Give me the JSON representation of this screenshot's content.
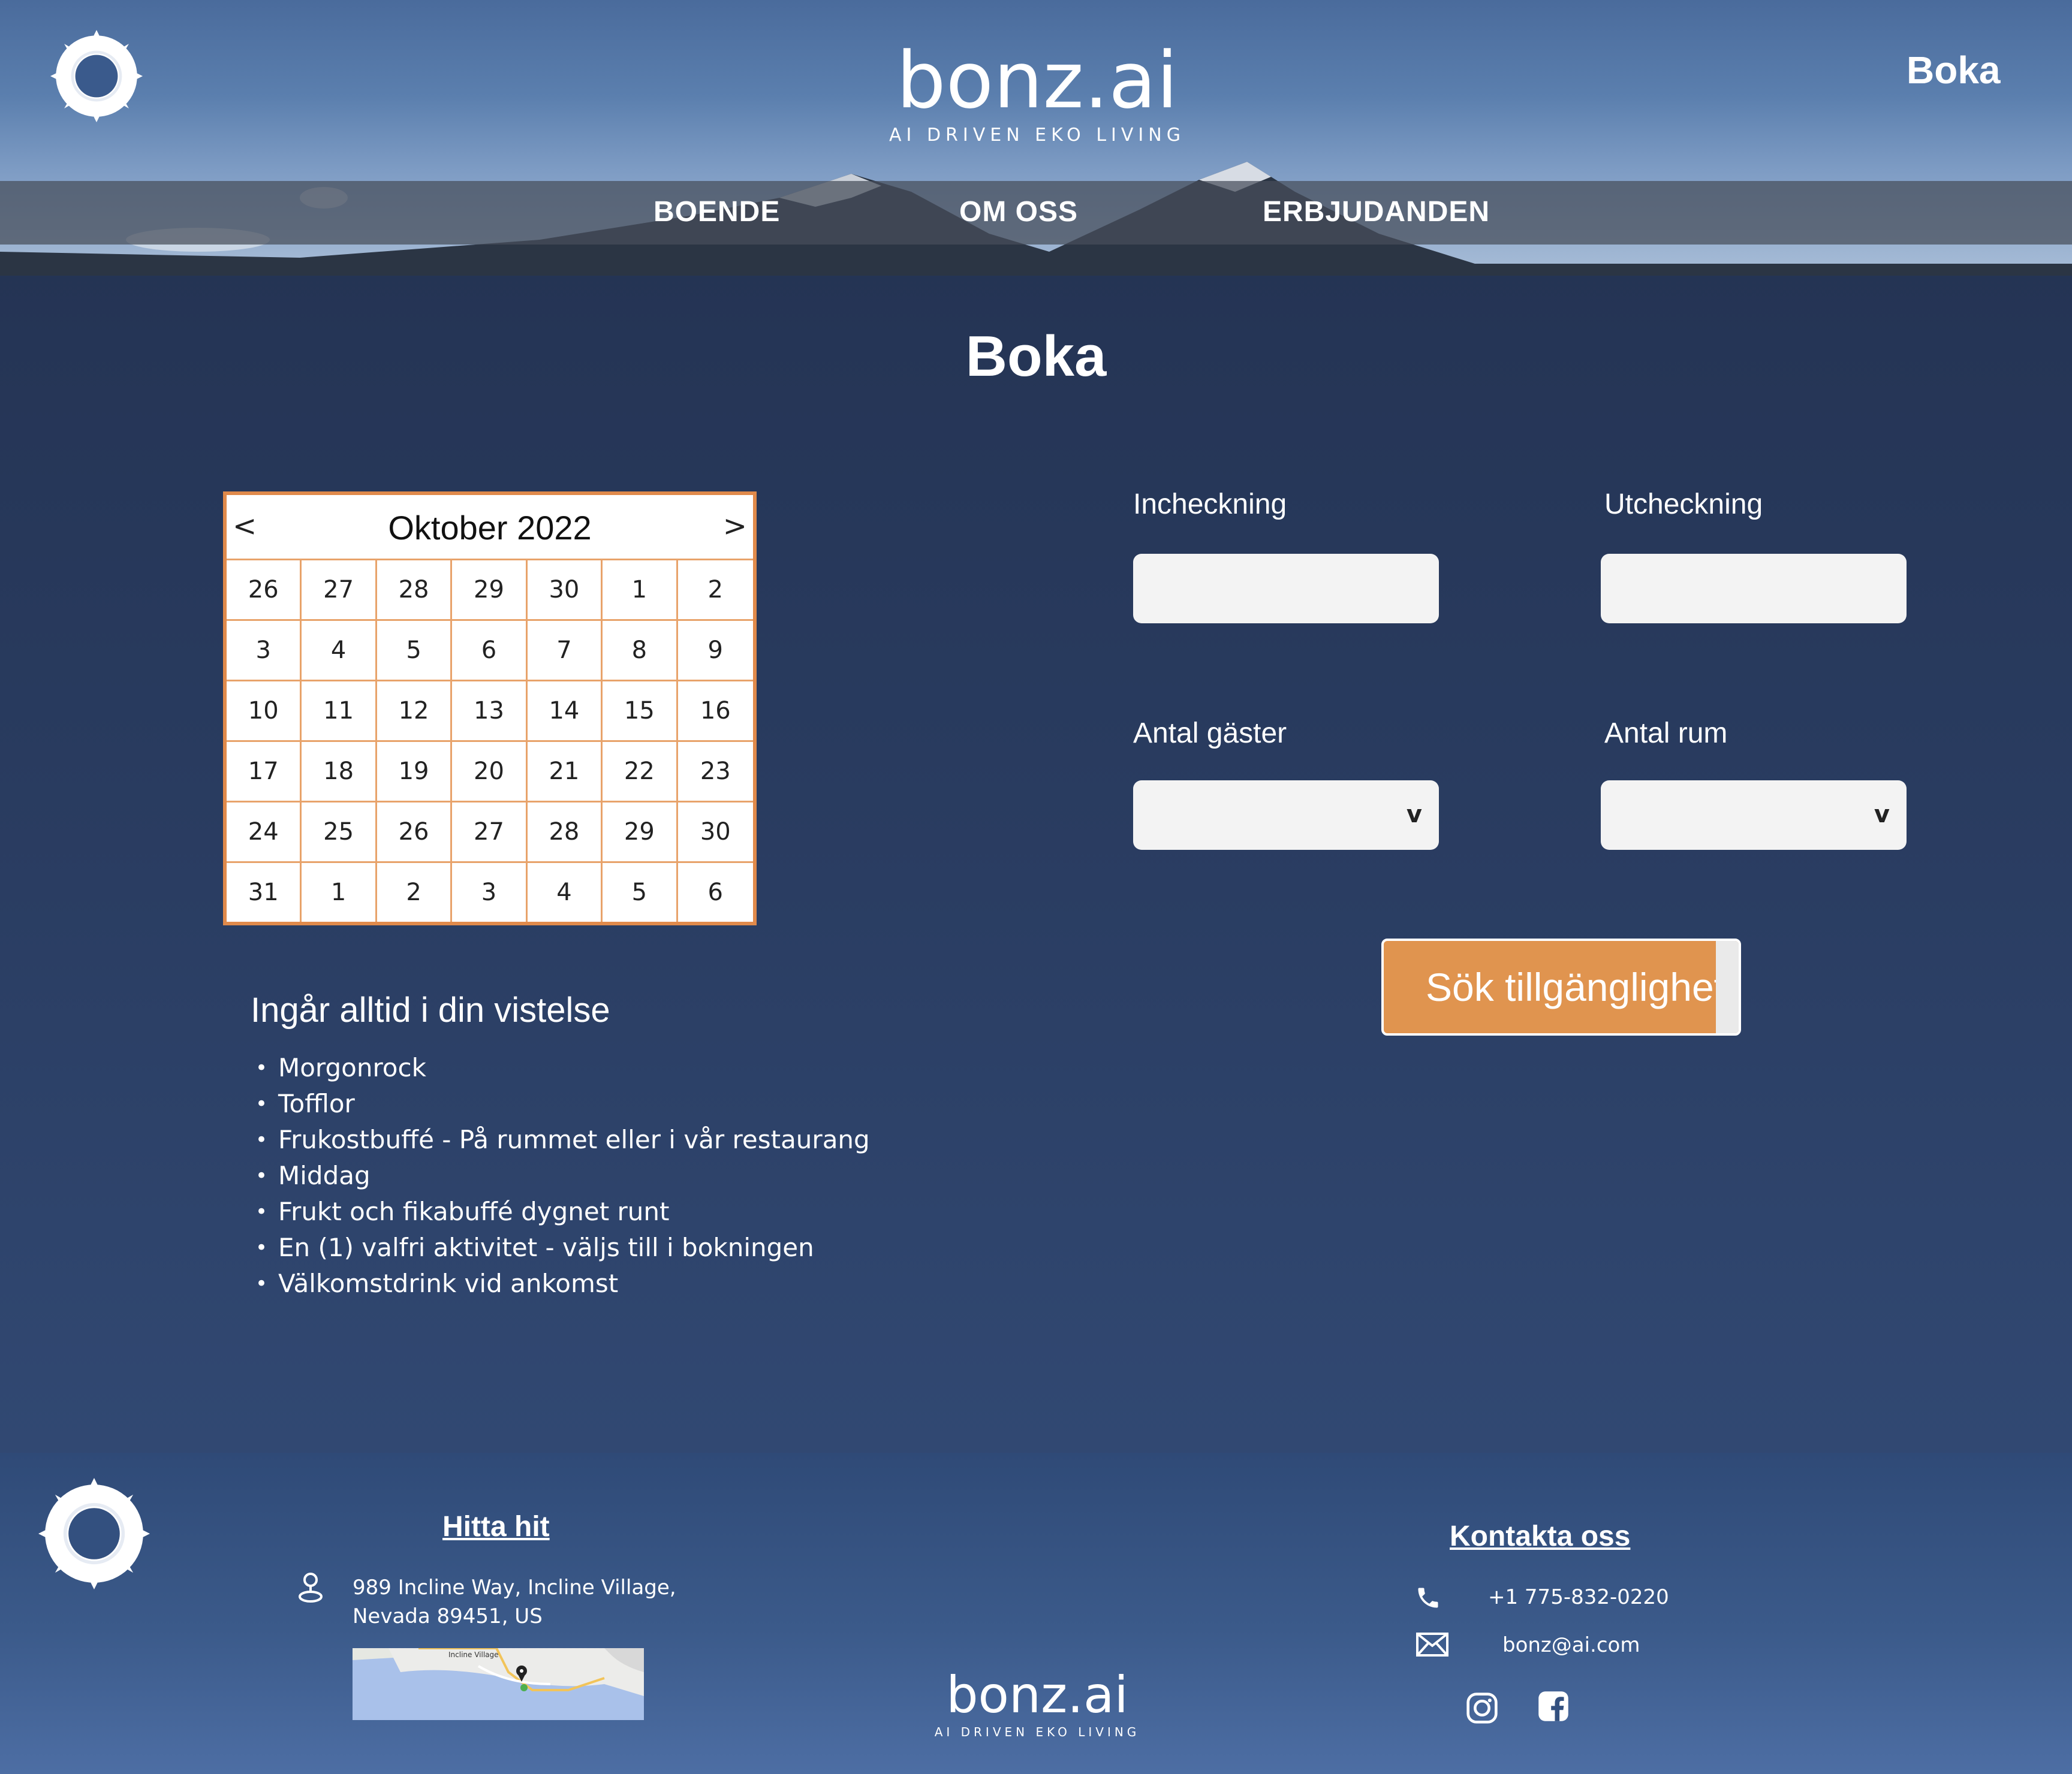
{
  "header": {
    "brand_name": "bonz.ai",
    "brand_tagline": "AI DRIVEN EKO LIVING",
    "top_link": "Boka"
  },
  "nav": {
    "items": [
      "BOENDE",
      "OM OSS",
      "ERBJUDANDEN"
    ]
  },
  "page": {
    "title": "Boka"
  },
  "calendar": {
    "month_label": "Oktober 2022",
    "prev_label": "<",
    "next_label": ">",
    "days": [
      [
        "26",
        "27",
        "28",
        "29",
        "30",
        "1",
        "2"
      ],
      [
        "3",
        "4",
        "5",
        "6",
        "7",
        "8",
        "9"
      ],
      [
        "10",
        "11",
        "12",
        "13",
        "14",
        "15",
        "16"
      ],
      [
        "17",
        "18",
        "19",
        "20",
        "21",
        "22",
        "23"
      ],
      [
        "24",
        "25",
        "26",
        "27",
        "28",
        "29",
        "30"
      ],
      [
        "31",
        "1",
        "2",
        "3",
        "4",
        "5",
        "6"
      ]
    ]
  },
  "included": {
    "title": "Ingår alltid i din vistelse",
    "items": [
      "Morgonrock",
      "Tofflor",
      "Frukostbuffé - På rummet eller i vår restaurang",
      "Middag",
      "Frukt och fikabuffé dygnet runt",
      "En (1) valfri aktivitet  - väljs till i bokningen",
      "Välkomstdrink vid ankomst"
    ]
  },
  "form": {
    "checkin_label": "Incheckning",
    "checkout_label": "Utcheckning",
    "guests_label": "Antal gäster",
    "rooms_label": "Antal rum",
    "select_chevron": "v",
    "search_button": "Sök tillgänglighet"
  },
  "footer": {
    "find_heading": "Hitta hit",
    "address_line1": "989 Incline Way, Incline Village,",
    "address_line2": "Nevada 89451, US",
    "contact_heading": "Kontakta oss",
    "phone": "+1 775-832-0220",
    "email": "bonz@ai.com",
    "brand_name": "bonz.ai",
    "brand_tagline": "AI DRIVEN EKO LIVING",
    "map_label": "Incline Village"
  },
  "colors": {
    "accent": "#e0944f",
    "calendar_border": "#e08a4b",
    "background_top": "#22304e",
    "background_bottom": "#354f7c"
  },
  "icons": [
    "sun-logo-icon",
    "location-pin-icon",
    "phone-icon",
    "mail-icon",
    "instagram-icon",
    "facebook-icon",
    "chevron-down-icon"
  ]
}
